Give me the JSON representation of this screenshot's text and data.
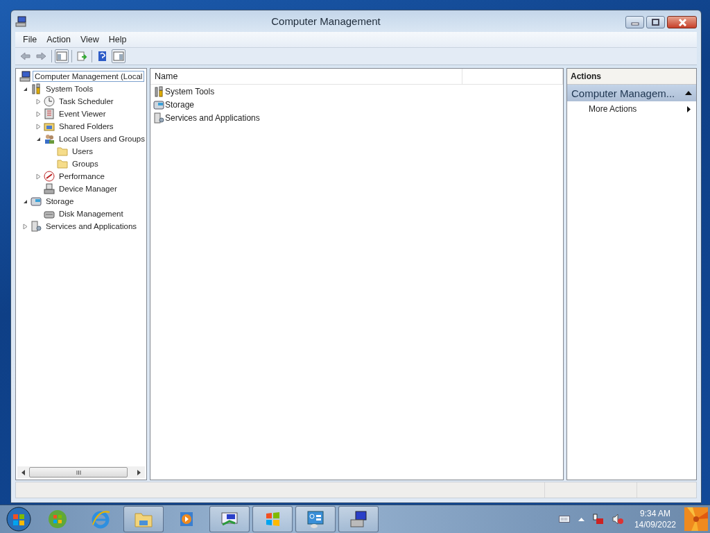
{
  "window": {
    "title": "Computer Management"
  },
  "menu": [
    "File",
    "Action",
    "View",
    "Help"
  ],
  "toolbar": [
    {
      "kind": "back",
      "disabled": true
    },
    {
      "kind": "forward",
      "disabled": true
    },
    {
      "kind": "sep"
    },
    {
      "kind": "panel",
      "disabled": false
    },
    {
      "kind": "sep"
    },
    {
      "kind": "export",
      "disabled": false
    },
    {
      "kind": "sep"
    },
    {
      "kind": "help",
      "disabled": false
    },
    {
      "kind": "panel2",
      "disabled": false
    }
  ],
  "tree": [
    {
      "label": "Computer Management (Local",
      "kind": "computer",
      "selected": true,
      "children": [
        {
          "label": "System Tools",
          "kind": "tools",
          "selected": false,
          "expanded": true,
          "children": [
            {
              "label": "Task Scheduler",
              "kind": "clock",
              "selected": false,
              "expanded": false
            },
            {
              "label": "Event Viewer",
              "kind": "log",
              "selected": false,
              "expanded": false
            },
            {
              "label": "Shared Folders",
              "kind": "share",
              "selected": false,
              "expanded": false
            },
            {
              "label": "Local Users and Groups",
              "kind": "users",
              "selected": false,
              "expanded": true,
              "children": [
                {
                  "label": "Users",
                  "kind": "folder",
                  "selected": false
                },
                {
                  "label": "Groups",
                  "kind": "folder",
                  "selected": false
                }
              ]
            },
            {
              "label": "Performance",
              "kind": "perf",
              "selected": false,
              "expanded": false
            },
            {
              "label": "Device Manager",
              "kind": "device",
              "selected": false
            }
          ]
        },
        {
          "label": "Storage",
          "kind": "storage",
          "selected": false,
          "expanded": true,
          "children": [
            {
              "label": "Disk Management",
              "kind": "disk",
              "selected": false
            }
          ]
        },
        {
          "label": "Services and Applications",
          "kind": "services",
          "selected": false,
          "expanded": false
        }
      ]
    }
  ],
  "list": {
    "columns": [
      "Name"
    ],
    "rows": [
      {
        "name": "System Tools",
        "kind": "tools"
      },
      {
        "name": "Storage",
        "kind": "storage"
      },
      {
        "name": "Services and Applications",
        "kind": "services"
      }
    ]
  },
  "actions": {
    "header": "Actions",
    "section": "Computer Managem...",
    "items": [
      {
        "label": "More Actions"
      }
    ]
  },
  "taskbar": {
    "items": [
      {
        "kind": "orb",
        "open": false
      },
      {
        "kind": "ie",
        "open": false
      },
      {
        "kind": "folder",
        "open": true
      },
      {
        "kind": "media",
        "open": false
      },
      {
        "kind": "network",
        "open": true
      },
      {
        "kind": "windows",
        "open": true
      },
      {
        "kind": "control",
        "open": true
      },
      {
        "kind": "computer",
        "open": true
      }
    ],
    "time": "9:34 AM",
    "date": "14/09/2022"
  }
}
